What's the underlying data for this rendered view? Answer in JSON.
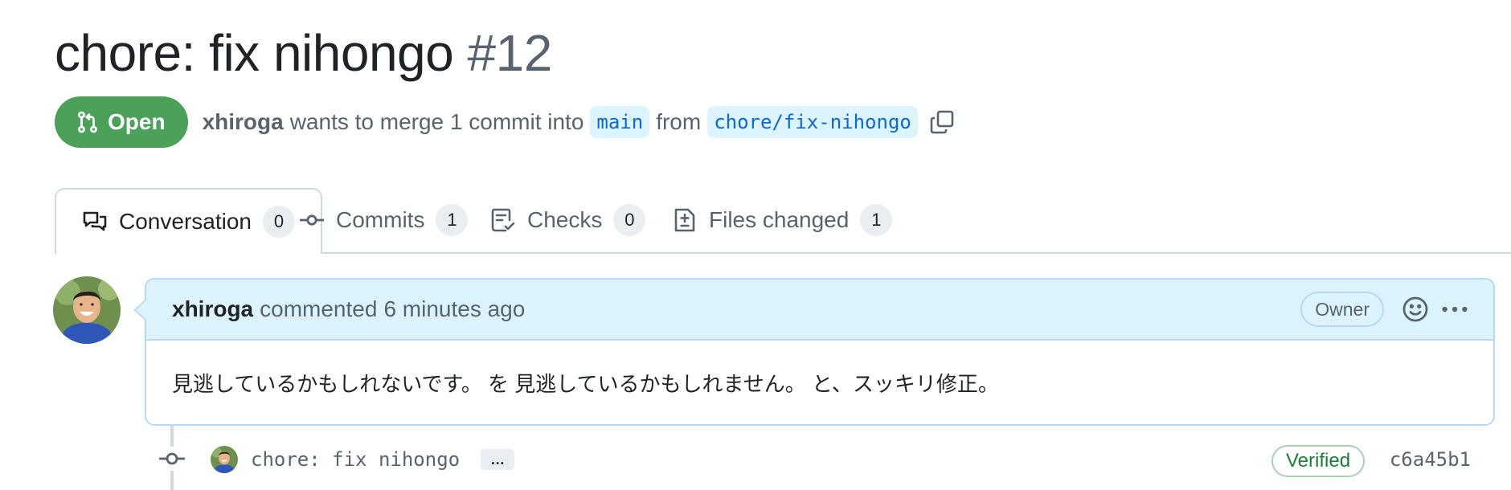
{
  "pr": {
    "title": "chore: fix nihongo",
    "number": "#12",
    "state": "Open",
    "author": "xhiroga",
    "merge_text_1": "wants to merge 1 commit into",
    "base_branch": "main",
    "merge_text_2": "from",
    "head_branch": "chore/fix-nihongo"
  },
  "tabs": [
    {
      "label": "Conversation",
      "count": "0",
      "icon": "comment-discussion-icon"
    },
    {
      "label": "Commits",
      "count": "1",
      "icon": "git-commit-icon"
    },
    {
      "label": "Checks",
      "count": "0",
      "icon": "checklist-icon"
    },
    {
      "label": "Files changed",
      "count": "1",
      "icon": "file-diff-icon"
    }
  ],
  "comment": {
    "author": "xhiroga",
    "action": "commented",
    "time": "6 minutes ago",
    "badge": "Owner",
    "body": "見逃しているかもしれないです。 を 見逃しているかもしれません。 と、スッキリ修正。"
  },
  "commit": {
    "message": "chore: fix nihongo",
    "ellipsis": "…",
    "verified": "Verified",
    "sha": "c6a45b1"
  },
  "colors": {
    "open_green": "#4aa157",
    "link_blue": "#0969da",
    "verified_green": "#1a7f37",
    "comment_header_bg": "#ddf4ff"
  }
}
